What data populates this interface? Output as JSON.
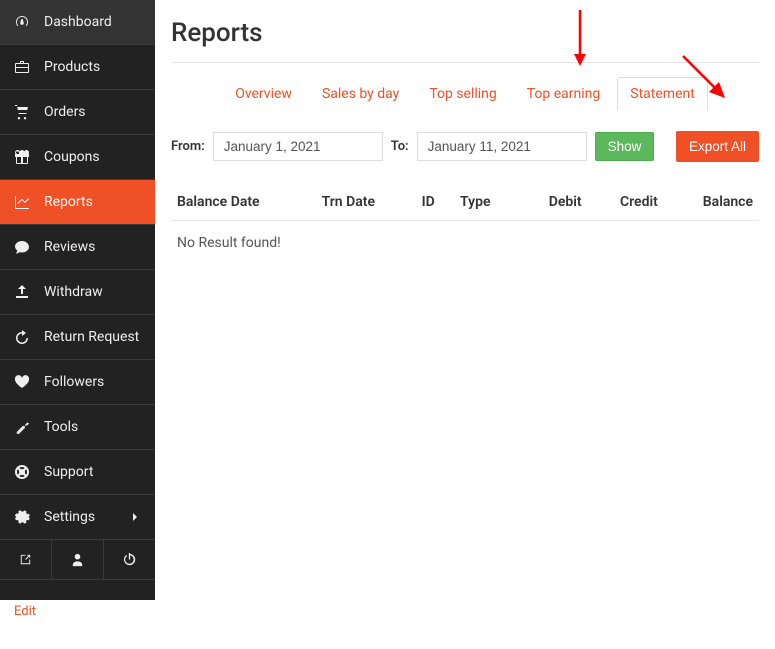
{
  "sidebar": {
    "items": [
      {
        "label": "Dashboard",
        "id": "dashboard"
      },
      {
        "label": "Products",
        "id": "products"
      },
      {
        "label": "Orders",
        "id": "orders"
      },
      {
        "label": "Coupons",
        "id": "coupons"
      },
      {
        "label": "Reports",
        "id": "reports"
      },
      {
        "label": "Reviews",
        "id": "reviews"
      },
      {
        "label": "Withdraw",
        "id": "withdraw"
      },
      {
        "label": "Return Request",
        "id": "return-request"
      },
      {
        "label": "Followers",
        "id": "followers"
      },
      {
        "label": "Tools",
        "id": "tools"
      },
      {
        "label": "Support",
        "id": "support"
      },
      {
        "label": "Settings",
        "id": "settings"
      }
    ]
  },
  "page": {
    "title": "Reports",
    "tabs": [
      {
        "label": "Overview"
      },
      {
        "label": "Sales by day"
      },
      {
        "label": "Top selling"
      },
      {
        "label": "Top earning"
      },
      {
        "label": "Statement"
      }
    ],
    "filter": {
      "from_label": "From:",
      "to_label": "To:",
      "from_value": "January 1, 2021",
      "to_value": "January 11, 2021",
      "show_label": "Show",
      "export_label": "Export All"
    },
    "table": {
      "columns": [
        "Balance Date",
        "Trn Date",
        "ID",
        "Type",
        "Debit",
        "Credit",
        "Balance"
      ],
      "empty_message": "No Result found!"
    }
  },
  "edit_label": "Edit"
}
